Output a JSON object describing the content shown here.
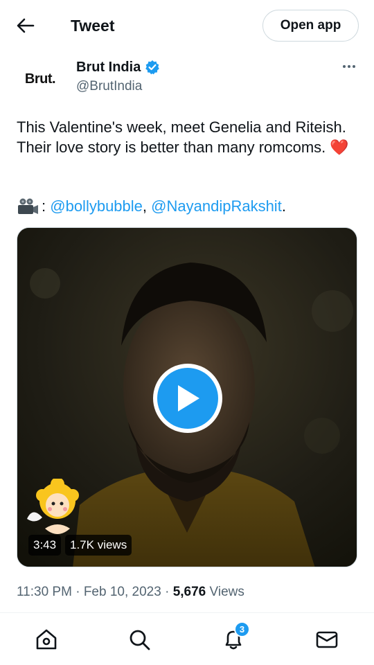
{
  "header": {
    "title": "Tweet",
    "open_app_label": "Open app",
    "back_icon": "arrow-left-icon"
  },
  "author": {
    "avatar_text": "Brut.",
    "name": "Brut India",
    "handle": "@BrutIndia",
    "verified": true,
    "verified_color": "#1d9bf0"
  },
  "tweet": {
    "text": "This Valentine's week, meet Genelia and Riteish. Their love story is better than many romcoms.",
    "heart_glyph": "❤️",
    "credit_separator": ":",
    "mentions": [
      "@bollybubble",
      "@NayandipRakshit"
    ],
    "mention_join": ",",
    "credit_end": "."
  },
  "media": {
    "type": "video",
    "duration": "3:43",
    "views": "1.7K views",
    "play_icon": "play-icon"
  },
  "meta": {
    "time": "11:30 PM",
    "date": "Feb 10, 2023",
    "separator": "·",
    "view_count": "5,676",
    "views_label": "Views"
  },
  "nav": {
    "items": [
      "home-icon",
      "search-icon",
      "notifications-icon",
      "messages-icon"
    ],
    "notifications_badge": "3"
  },
  "colors": {
    "accent": "#1d9bf0",
    "text_primary": "#0f1419",
    "text_secondary": "#536471",
    "heart": "#e0245e"
  }
}
